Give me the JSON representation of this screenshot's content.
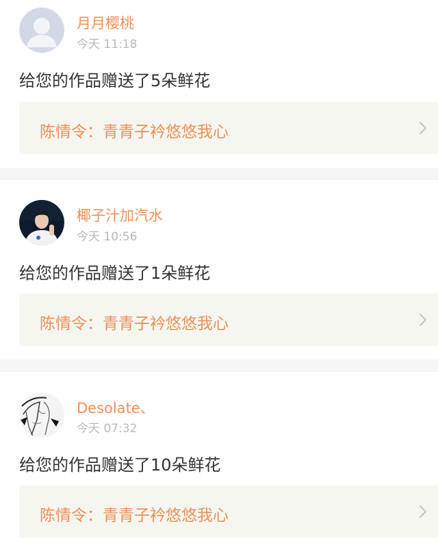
{
  "colors": {
    "accent": "#ef8f56",
    "text": "#333333",
    "muted": "#b8b8b8",
    "link_bg": "#f6f6f1",
    "separator": "#f5f5f5"
  },
  "notifications": [
    {
      "username": "月月樱桃",
      "time": "今天 11:18",
      "message": "给您的作品赠送了5朵鲜花",
      "work_title": "陈情令：青青子衿悠悠我心",
      "avatar_icon": "default-avatar-icon"
    },
    {
      "username": "椰子汁加汽水",
      "time": "今天 10:56",
      "message": "给您的作品赠送了1朵鲜花",
      "work_title": "陈情令：青青子衿悠悠我心",
      "avatar_icon": "photo-avatar-icon"
    },
    {
      "username": "Desolate、",
      "time": "今天 07:32",
      "message": "给您的作品赠送了10朵鲜花",
      "work_title": "陈情令：青青子衿悠悠我心",
      "avatar_icon": "sketch-avatar-icon"
    }
  ]
}
